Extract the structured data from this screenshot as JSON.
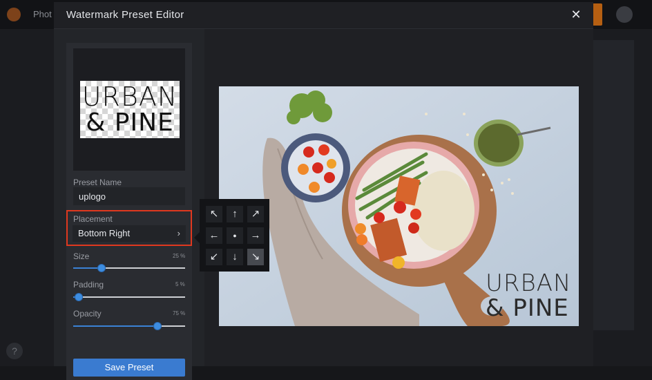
{
  "app": {
    "title": "Phot"
  },
  "modal": {
    "title": "Watermark Preset Editor",
    "close_glyph": "✕"
  },
  "logo_preview": {
    "line1": "URBAN",
    "line2": "& PINE"
  },
  "form": {
    "preset_name_label": "Preset Name",
    "preset_name_value": "uplogo",
    "placement_label": "Placement",
    "placement_value": "Bottom Right",
    "placement_chevron": "›",
    "size": {
      "label": "Size",
      "value_text": "25 %",
      "value": 25
    },
    "padding": {
      "label": "Padding",
      "value_text": "5 %",
      "value": 5
    },
    "opacity": {
      "label": "Opacity",
      "value_text": "75 %",
      "value": 75
    },
    "save_label": "Save Preset"
  },
  "placement_grid": [
    {
      "name": "top-left",
      "glyph": "↖"
    },
    {
      "name": "top-center",
      "glyph": "↑"
    },
    {
      "name": "top-right",
      "glyph": "↗"
    },
    {
      "name": "middle-left",
      "glyph": "←"
    },
    {
      "name": "center",
      "glyph": "●"
    },
    {
      "name": "middle-right",
      "glyph": "→"
    },
    {
      "name": "bottom-left",
      "glyph": "↙"
    },
    {
      "name": "bottom-center",
      "glyph": "↓"
    },
    {
      "name": "bottom-right",
      "glyph": "↘",
      "active": true
    }
  ],
  "watermark": {
    "line1": "URBAN",
    "line2": "& PINE"
  },
  "colors": {
    "accent": "#3b82d6",
    "highlight": "#e0381f",
    "modal_bg": "#1f2024"
  }
}
